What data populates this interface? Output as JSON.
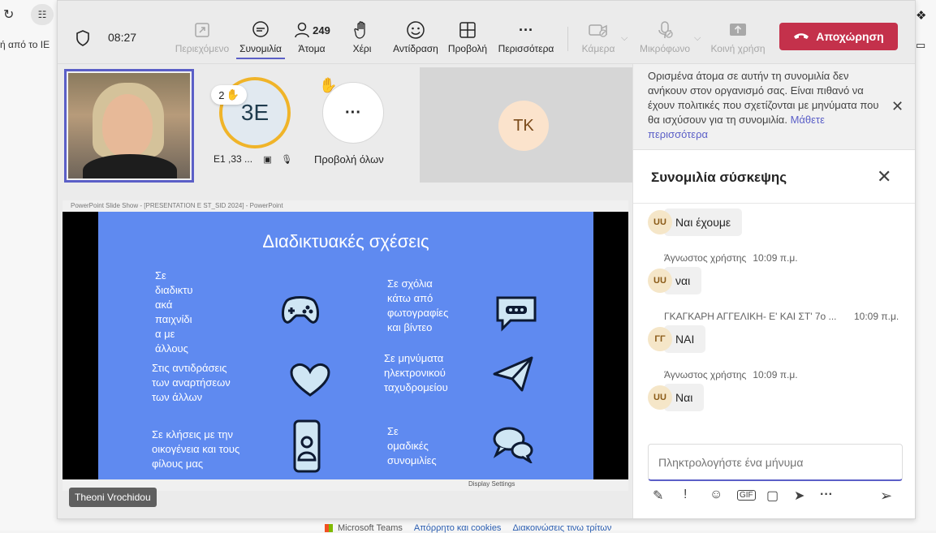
{
  "browser": {
    "left_ie_text": "ή από το IE",
    "footer": {
      "brand": "Microsoft Teams",
      "link1": "Απόρρητο και cookies",
      "link2": "Διακοινώσεις τινω τρίτων"
    }
  },
  "toolbar": {
    "time": "08:27",
    "content_label": "Περιεχόμενο",
    "chat_label": "Συνομιλία",
    "people_label": "Άτομα",
    "people_count": "249",
    "raise_label": "Χέρι",
    "react_label": "Αντίδραση",
    "view_label": "Προβολή",
    "more_label": "Περισσότερα",
    "camera_label": "Κάμερα",
    "mic_label": "Μικρόφωνο",
    "share_label": "Κοινή χρήση",
    "leave_label": "Αποχώρηση"
  },
  "stage": {
    "participant_3e": {
      "initials": "3E",
      "name": "E1 ,33 ...",
      "hand_count": "2"
    },
    "view_all": "Προβολή όλων",
    "tk_initials": "TK",
    "share_title": "PowerPoint Slide Show - [PRESENTATION E ST_SID 2024] - PowerPoint",
    "display_settings": "Display Settings",
    "presenter": "Theoni Vrochidou"
  },
  "slide": {
    "title": "Διαδικτυακές σχέσεις",
    "items": [
      "Σε\nδιαδικτυ\nακά\nπαιχνίδι\nα με\nάλλους",
      "Σε σχόλια\nκάτω από\nφωτογραφίες\nκαι βίντεο",
      "Στις αντιδράσεις\nτων αναρτήσεων\nτων άλλων",
      "Σε μηνύματα\nηλεκτρονικού\nταχυδρομείου",
      "Σε κλήσεις με την\nοικογένεια και τους\nφίλους μας",
      "Σε\nομαδικές\nσυνομιλίες"
    ],
    "icons": [
      "gamepad-icon",
      "comment-icon",
      "heart-icon",
      "paper-plane-icon",
      "phone-icon",
      "chat-bubbles-icon"
    ]
  },
  "chat": {
    "banner_text": "Ορισμένα άτομα σε αυτήν τη συνομιλία δεν ανήκουν στον οργανισμό σας. Είναι πιθανό να έχουν πολιτικές που σχετίζονται με μηνύματα που θα ισχύσουν για τη συνομιλία.",
    "banner_link": "Μάθετε περισσότερα",
    "title": "Συνομιλία σύσκεψης",
    "messages": [
      {
        "avatar": "UU",
        "text": "Ναι έχουμε"
      },
      {
        "author": "Άγνωστος χρήστης",
        "time": "10:09 π.μ.",
        "avatar": "UU",
        "text": "ναι"
      },
      {
        "author": "ΓΚΑΓΚΑΡΗ ΑΓΓΕΛΙΚΗ- Ε' ΚΑΙ ΣΤ' 7ο ...",
        "time": "10:09 π.μ.",
        "avatar": "ΓΓ",
        "text": "ΝΑΙ"
      },
      {
        "author": "Άγνωστος χρήστης",
        "time": "10:09 π.μ.",
        "avatar": "UU",
        "text": "Ναι"
      }
    ],
    "compose_placeholder": "Πληκτρολογήστε ένα μήνυμα"
  }
}
